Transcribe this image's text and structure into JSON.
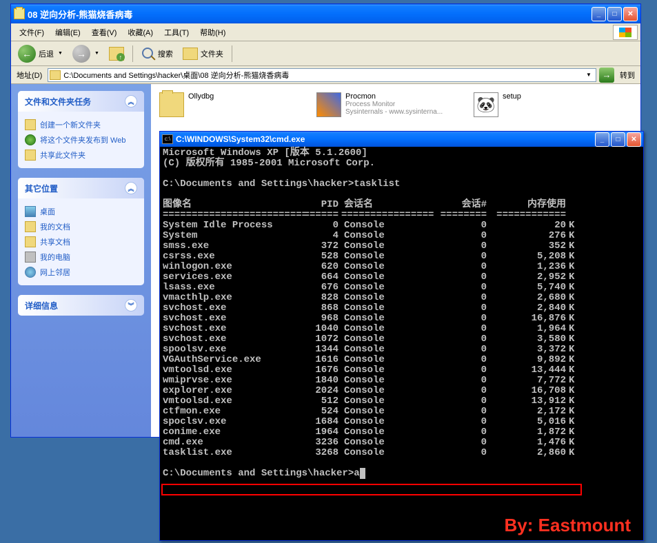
{
  "explorer": {
    "title": "08 逆向分析-熊猫烧香病毒",
    "menu": [
      "文件(F)",
      "编辑(E)",
      "查看(V)",
      "收藏(A)",
      "工具(T)",
      "帮助(H)"
    ],
    "toolbar": {
      "back": "后退",
      "search": "搜索",
      "folders": "文件夹"
    },
    "address_label": "地址(D)",
    "address_path": "C:\\Documents and Settings\\hacker\\桌面\\08 逆向分析-熊猫烧香病毒",
    "go_label": "转到",
    "sidebar": {
      "panel1_title": "文件和文件夹任务",
      "panel1_items": [
        "创建一个新文件夹",
        "将这个文件夹发布到 Web",
        "共享此文件夹"
      ],
      "panel2_title": "其它位置",
      "panel2_items": [
        "桌面",
        "我的文档",
        "共享文档",
        "我的电脑",
        "网上邻居"
      ],
      "panel3_title": "详细信息"
    },
    "files": [
      {
        "name": "Ollydbg",
        "sub1": "",
        "sub2": ""
      },
      {
        "name": "Procmon",
        "sub1": "Process Monitor",
        "sub2": "Sysinternals - www.sysinterna..."
      },
      {
        "name": "setup",
        "sub1": "",
        "sub2": ""
      }
    ]
  },
  "cmd": {
    "title": "C:\\WINDOWS\\System32\\cmd.exe",
    "header1": "Microsoft Windows XP [版本 5.1.2600]",
    "header2": "(C) 版权所有 1985-2001 Microsoft Corp.",
    "prompt1": "C:\\Documents and Settings\\hacker>tasklist",
    "col_headers": {
      "name": "图像名",
      "pid": "PID",
      "sess": "会话名",
      "sid": "会话#",
      "mem": "内存使用"
    },
    "sep": {
      "name": "=========================",
      "pid": "======",
      "sess": "================",
      "sid": "========",
      "mem": "============"
    },
    "rows": [
      {
        "name": "System Idle Process",
        "pid": "0",
        "sess": "Console",
        "sid": "0",
        "mem": "20"
      },
      {
        "name": "System",
        "pid": "4",
        "sess": "Console",
        "sid": "0",
        "mem": "276"
      },
      {
        "name": "smss.exe",
        "pid": "372",
        "sess": "Console",
        "sid": "0",
        "mem": "352"
      },
      {
        "name": "csrss.exe",
        "pid": "528",
        "sess": "Console",
        "sid": "0",
        "mem": "5,208"
      },
      {
        "name": "winlogon.exe",
        "pid": "620",
        "sess": "Console",
        "sid": "0",
        "mem": "1,236"
      },
      {
        "name": "services.exe",
        "pid": "664",
        "sess": "Console",
        "sid": "0",
        "mem": "2,952"
      },
      {
        "name": "lsass.exe",
        "pid": "676",
        "sess": "Console",
        "sid": "0",
        "mem": "5,740"
      },
      {
        "name": "vmacthlp.exe",
        "pid": "828",
        "sess": "Console",
        "sid": "0",
        "mem": "2,680"
      },
      {
        "name": "svchost.exe",
        "pid": "868",
        "sess": "Console",
        "sid": "0",
        "mem": "2,840"
      },
      {
        "name": "svchost.exe",
        "pid": "968",
        "sess": "Console",
        "sid": "0",
        "mem": "16,876"
      },
      {
        "name": "svchost.exe",
        "pid": "1040",
        "sess": "Console",
        "sid": "0",
        "mem": "1,964"
      },
      {
        "name": "svchost.exe",
        "pid": "1072",
        "sess": "Console",
        "sid": "0",
        "mem": "3,580"
      },
      {
        "name": "spoolsv.exe",
        "pid": "1344",
        "sess": "Console",
        "sid": "0",
        "mem": "3,372"
      },
      {
        "name": "VGAuthService.exe",
        "pid": "1616",
        "sess": "Console",
        "sid": "0",
        "mem": "9,892"
      },
      {
        "name": "vmtoolsd.exe",
        "pid": "1676",
        "sess": "Console",
        "sid": "0",
        "mem": "13,444"
      },
      {
        "name": "wmiprvse.exe",
        "pid": "1840",
        "sess": "Console",
        "sid": "0",
        "mem": "7,772"
      },
      {
        "name": "explorer.exe",
        "pid": "2024",
        "sess": "Console",
        "sid": "0",
        "mem": "16,708"
      },
      {
        "name": "vmtoolsd.exe",
        "pid": "512",
        "sess": "Console",
        "sid": "0",
        "mem": "13,912"
      },
      {
        "name": "ctfmon.exe",
        "pid": "524",
        "sess": "Console",
        "sid": "0",
        "mem": "2,172"
      },
      {
        "name": "spoclsv.exe",
        "pid": "1684",
        "sess": "Console",
        "sid": "0",
        "mem": "5,016"
      },
      {
        "name": "conime.exe",
        "pid": "1964",
        "sess": "Console",
        "sid": "0",
        "mem": "1,872"
      },
      {
        "name": "cmd.exe",
        "pid": "3236",
        "sess": "Console",
        "sid": "0",
        "mem": "1,476"
      },
      {
        "name": "tasklist.exe",
        "pid": "3268",
        "sess": "Console",
        "sid": "0",
        "mem": "2,860"
      }
    ],
    "prompt2": "C:\\Documents and Settings\\hacker>a",
    "watermark": "By: Eastmount"
  }
}
